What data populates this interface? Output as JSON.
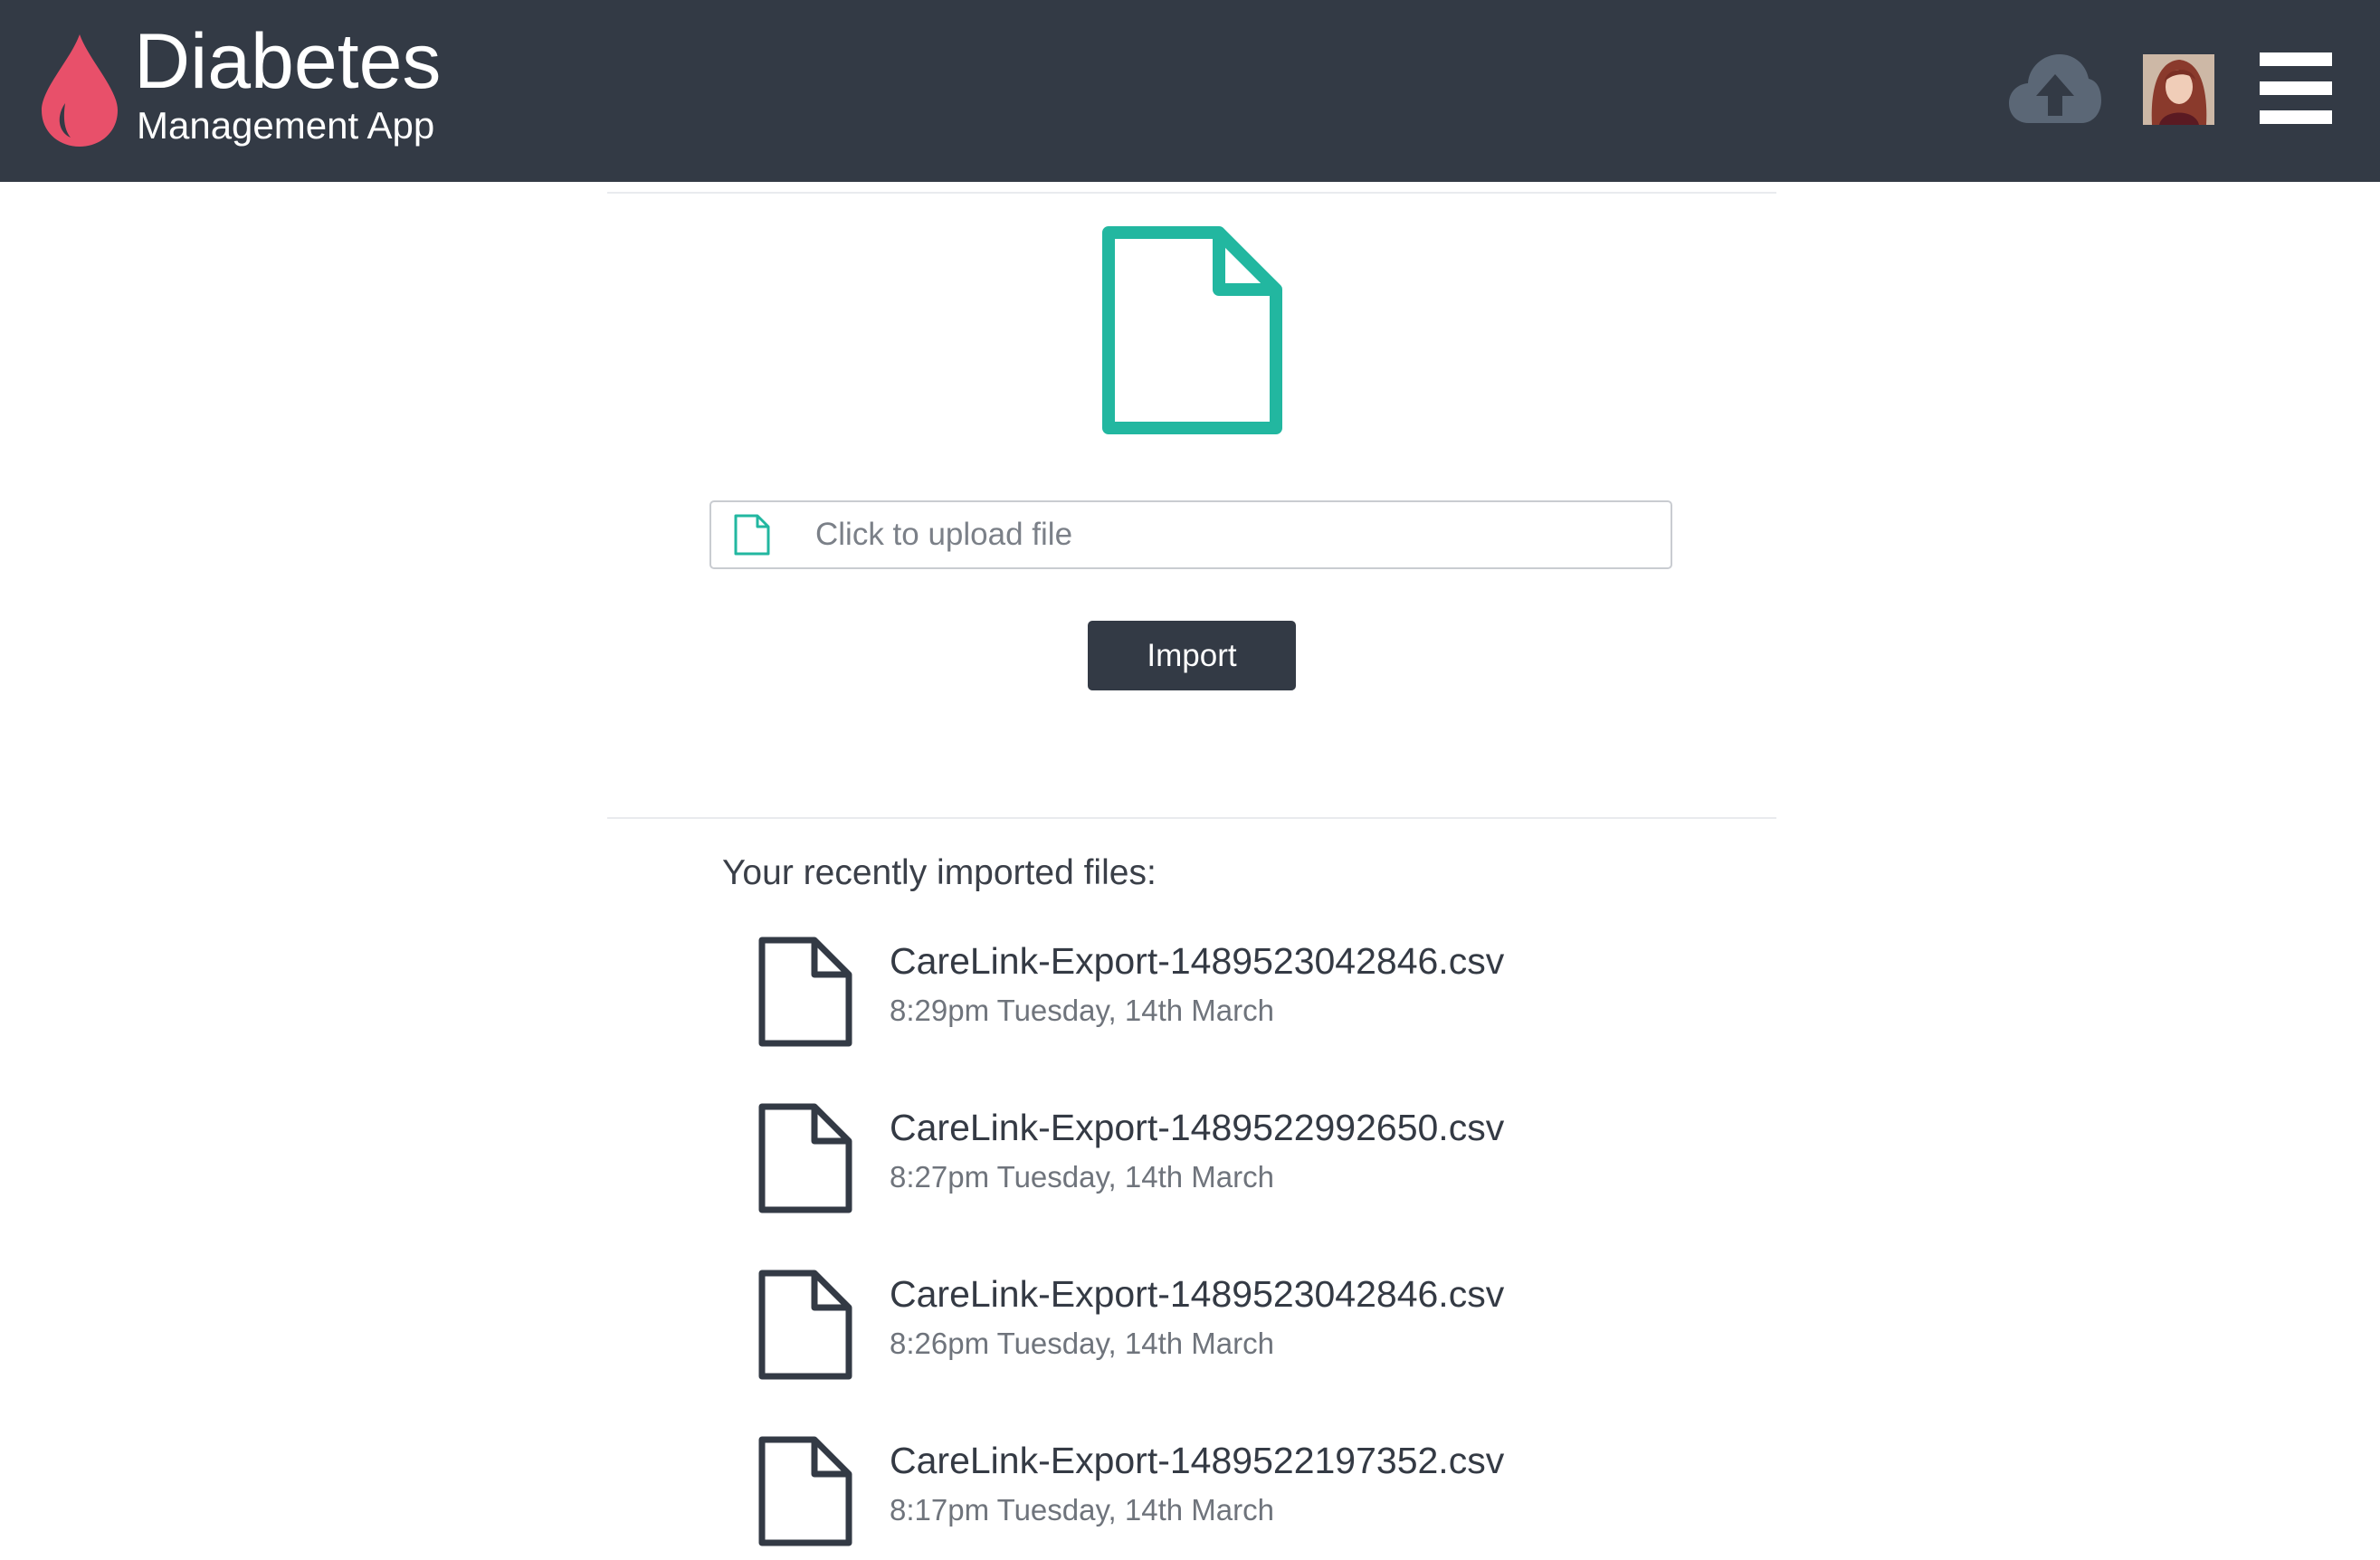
{
  "app": {
    "title": "Diabetes",
    "subtitle": "Management App",
    "brand_color": "#e8506a",
    "header_color": "#333a45"
  },
  "header_actions": {
    "upload_icon": "cloud-upload-icon",
    "avatar": "user-avatar",
    "menu_icon": "hamburger-menu-icon"
  },
  "upload": {
    "hero_icon": "file-icon",
    "accent_color": "#22b7a0",
    "placeholder": "Click to upload file",
    "import_label": "Import"
  },
  "recent": {
    "heading": "Your recently imported files:",
    "files": [
      {
        "name": "CareLink-Export-1489523042846.csv",
        "date": "8:29pm Tuesday, 14th March"
      },
      {
        "name": "CareLink-Export-1489522992650.csv",
        "date": "8:27pm Tuesday, 14th March"
      },
      {
        "name": "CareLink-Export-1489523042846.csv",
        "date": "8:26pm Tuesday, 14th March"
      },
      {
        "name": "CareLink-Export-1489522197352.csv",
        "date": "8:17pm Tuesday, 14th March"
      }
    ]
  }
}
